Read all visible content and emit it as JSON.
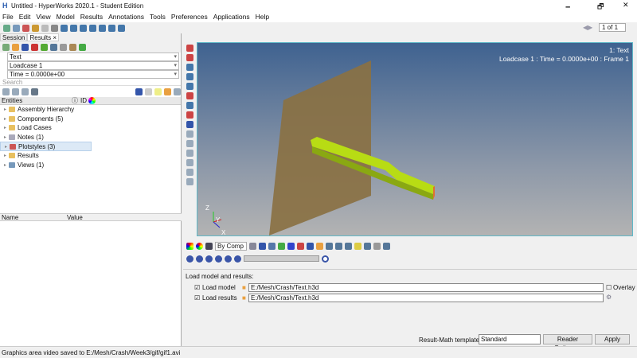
{
  "window": {
    "title": "Untitled - HyperWorks 2020.1 - Student Edition",
    "minimize": "🗕",
    "restore": "🗗",
    "close": "✕"
  },
  "menu": [
    "File",
    "Edit",
    "View",
    "Model",
    "Results",
    "Annotations",
    "Tools",
    "Preferences",
    "Applications",
    "Help"
  ],
  "toolbar": {
    "page": "1 of 1"
  },
  "left": {
    "tabs": [
      "Session",
      "Results ×"
    ],
    "selects": [
      "Text",
      "Loadcase 1",
      "Time = 0.0000e+00"
    ],
    "search_placeholder": "Search",
    "entities_header": "Entities",
    "id_header": "ID",
    "tree": [
      "Assembly Hierarchy",
      "Components (5)",
      "Load Cases",
      "Notes (1)",
      "Plotstyles (3)",
      "Results",
      "Views (1)"
    ],
    "props": {
      "name": "Name",
      "value": "Value"
    }
  },
  "graphics": {
    "label1": "1: Text",
    "label2": "Loadcase 1 : Time = 0.0000e+00 : Frame 1",
    "axis": {
      "z": "Z",
      "y": "Y",
      "x": "X"
    }
  },
  "controls": {
    "color_mode": "By Comp"
  },
  "load": {
    "title": "Load model and results:",
    "model_label": "Load model",
    "model_path": "E:/Mesh/Crash/Text.h3d",
    "results_label": "Load results",
    "results_path": "E:/Mesh/Crash/Text.h3d",
    "overlay": "Overlay",
    "template_label": "Result-Math template:",
    "template_value": "Standard",
    "reader_options": "Reader Options...",
    "apply": "Apply"
  },
  "status": "Graphics area video saved to E:/Mesh/Crash/Week3/gif/gif1.avi"
}
